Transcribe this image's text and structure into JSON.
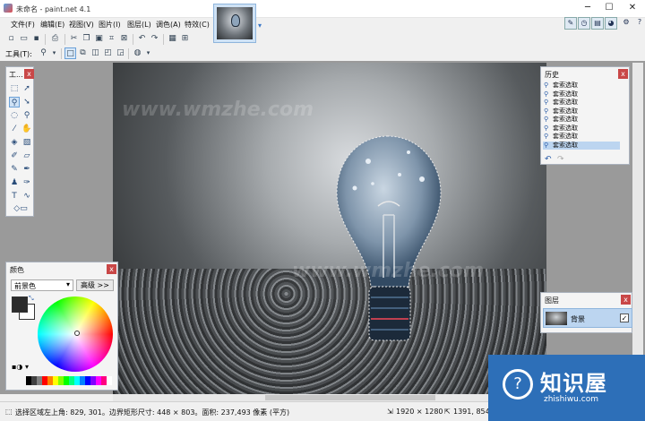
{
  "window": {
    "title": "未命名 - paint.net 4.1",
    "minimize": "─",
    "maximize": "☐",
    "close": "✕"
  },
  "menu": {
    "items": [
      "文件(F)",
      "编辑(E)",
      "视图(V)",
      "图片(I)",
      "图层(L)",
      "调色(A)",
      "特效(C)"
    ]
  },
  "toolbar2": {
    "tool_label": "工具(T):"
  },
  "tools_panel": {
    "title": "工..."
  },
  "history_panel": {
    "title": "历史",
    "items": [
      "套索选取",
      "套索选取",
      "套索选取",
      "套索选取",
      "套索选取",
      "套索选取",
      "套索选取",
      "套索选取"
    ],
    "selected_index": 7
  },
  "layers_panel": {
    "title": "图层",
    "layer_name": "背景",
    "checked": "✓"
  },
  "colors_panel": {
    "title": "颜色",
    "mode": "前景色",
    "advanced_button": "高级 >>",
    "primary_color": "#2b2b2b",
    "secondary_color": "#ffffff",
    "palette": [
      "#000000",
      "#404040",
      "#808080",
      "#ff0000",
      "#ff8000",
      "#ffff00",
      "#80ff00",
      "#00ff00",
      "#00ff80",
      "#00ffff",
      "#0080ff",
      "#0000ff",
      "#8000ff",
      "#ff00ff",
      "#ff0080",
      "#ffffff"
    ]
  },
  "status": {
    "selection": "选择区域左上角: 829, 301。边界矩形尺寸: 448 × 803。面积: 237,493 像素 (平方)",
    "image_size": "1920 × 1280",
    "cursor": "1391, 854"
  },
  "watermark": {
    "brand": "知识屋",
    "domain": "zhishiwu.com",
    "wm_text": "www.wmzhe.com"
  },
  "colors": {
    "accent": "#2d6fb8",
    "panel_close": "#c94747",
    "selection": "#bcd5f0"
  }
}
